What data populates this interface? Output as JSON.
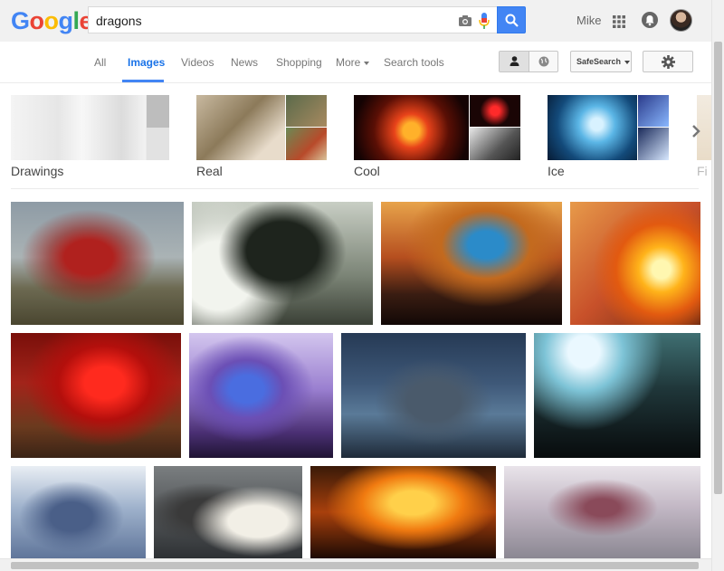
{
  "search": {
    "query": "dragons"
  },
  "header": {
    "user_name": "Mike"
  },
  "tabs": [
    {
      "label": "All"
    },
    {
      "label": "Images"
    },
    {
      "label": "Videos"
    },
    {
      "label": "News"
    },
    {
      "label": "Shopping"
    },
    {
      "label": "More"
    },
    {
      "label": "Search tools"
    }
  ],
  "toolbar": {
    "safesearch_label": "SafeSearch"
  },
  "related": [
    {
      "label": "Drawings"
    },
    {
      "label": "Real"
    },
    {
      "label": "Cool"
    },
    {
      "label": "Ice"
    },
    {
      "label": "Fi"
    }
  ],
  "colors": {
    "accent": "#4285f4",
    "logo_blue": "#4285f4",
    "logo_red": "#ea4335",
    "logo_yellow": "#fbbc05",
    "logo_green": "#34a853"
  },
  "icons": [
    "camera-icon",
    "microphone-icon",
    "search-icon",
    "apps-grid-icon",
    "bell-icon",
    "person-icon",
    "globe-icon",
    "gear-icon",
    "chevron-right-icon"
  ]
}
